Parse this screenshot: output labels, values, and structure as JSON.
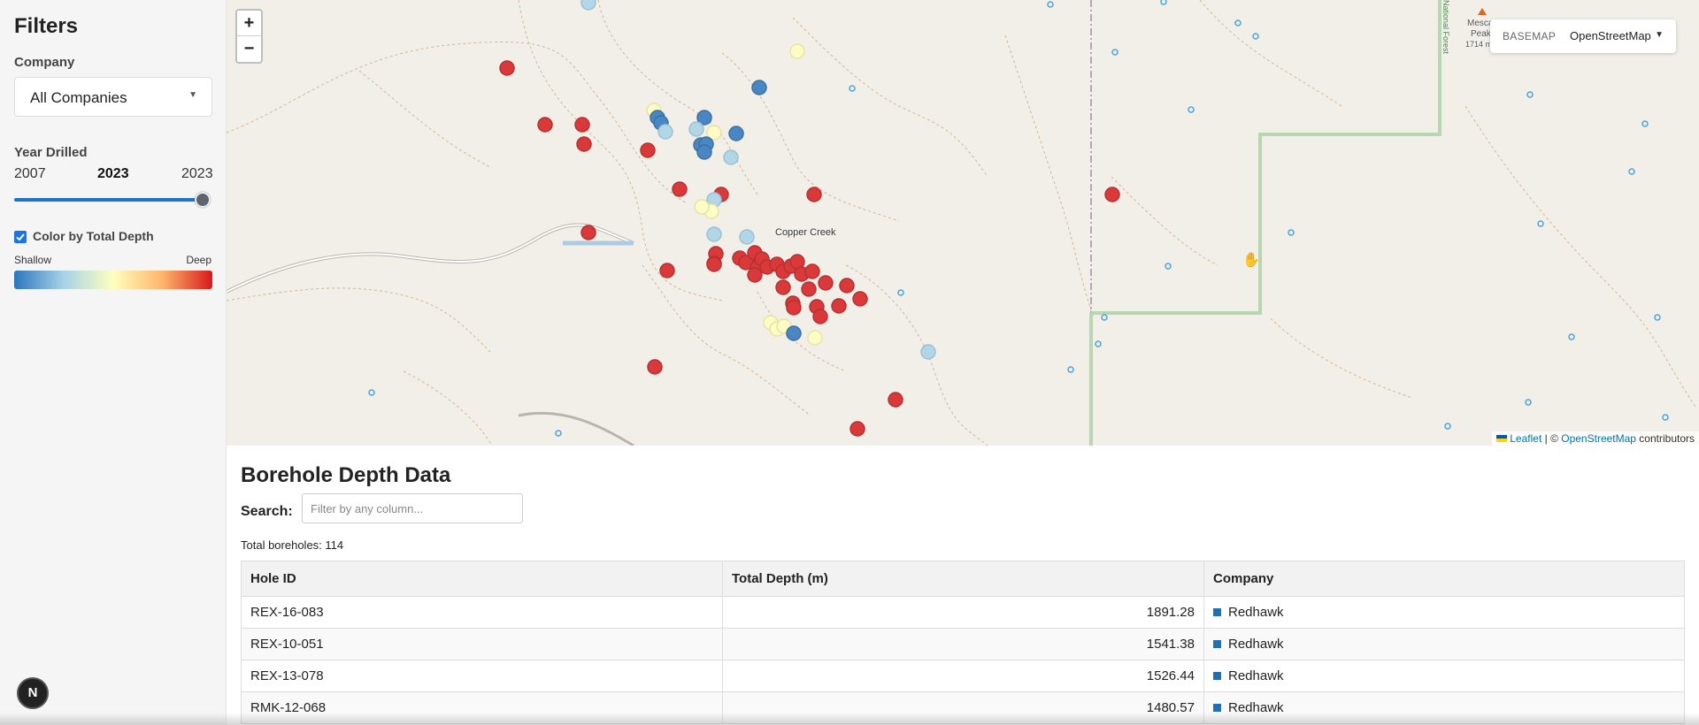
{
  "sidebar": {
    "title": "Filters",
    "company_label": "Company",
    "company_value": "All Companies",
    "year_label": "Year Drilled",
    "year_min": "2007",
    "year_current": "2023",
    "year_max": "2023",
    "year_slider_fraction": 1.0,
    "color_checkbox_label": "Color by Total Depth",
    "color_checkbox_checked": true,
    "gradient_low": "Shallow",
    "gradient_high": "Deep",
    "gradient_colors": [
      "#2b76bd",
      "#a8d2e6",
      "#ffffbf",
      "#fdb56a",
      "#d7191c"
    ]
  },
  "map": {
    "zoom_in": "+",
    "zoom_out": "−",
    "basemap_label": "BASEMAP",
    "basemap_value": "OpenStreetMap",
    "place_label": "Copper Creek",
    "peak_label_1": "Mesca",
    "peak_label_2": "Peak",
    "peak_label_3": "1714 m",
    "forest_label": "National Forest",
    "attribution_leaflet": "Leaflet",
    "attribution_sep": " | © ",
    "attribution_osm": "OpenStreetMap",
    "attribution_tail": " contributors"
  },
  "data": {
    "title": "Borehole Depth Data",
    "search_label": "Search:",
    "search_placeholder": "Filter by any column...",
    "total_text": "Total boreholes: 114",
    "columns": [
      "Hole ID",
      "Total Depth (m)",
      "Company"
    ],
    "rows": [
      {
        "hole_id": "REX-16-083",
        "depth": "1891.28",
        "company": "Redhawk",
        "color": "#1f6fb5"
      },
      {
        "hole_id": "REX-10-051",
        "depth": "1541.38",
        "company": "Redhawk",
        "color": "#1f6fb5"
      },
      {
        "hole_id": "REX-13-078",
        "depth": "1526.44",
        "company": "Redhawk",
        "color": "#1f6fb5"
      },
      {
        "hole_id": "RMK-12-068",
        "depth": "1480.57",
        "company": "Redhawk",
        "color": "#1f6fb5"
      }
    ]
  },
  "badge": "N"
}
